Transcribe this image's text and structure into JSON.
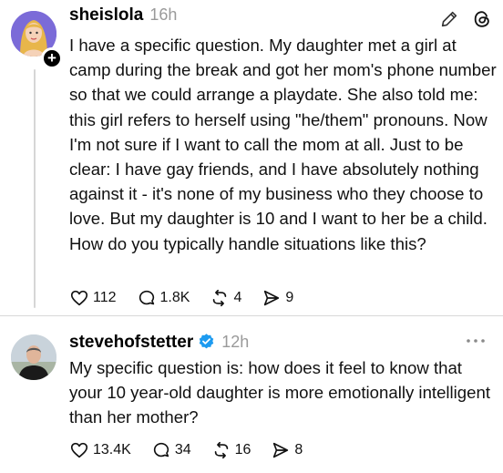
{
  "posts": [
    {
      "username": "sheislola",
      "time": "16h",
      "text": "I have a specific question. My daughter met a girl at camp during the break and got her mom's phone number so that we could arrange a playdate. She also told me: this girl refers to herself using \"he/them\" pronouns. Now I'm not sure if I want to call the mom at all. Just to be clear: I have gay friends, and I have absolutely nothing against it - it's none of my business who they choose to love. But my daughter is 10 and I want to her be a child. How do you typically handle situations like this?",
      "likes": "112",
      "replies": "1.8K",
      "reposts": "4",
      "shares": "9"
    },
    {
      "username": "stevehofstetter",
      "time": "12h",
      "text": "My specific question is: how does it feel to know that your 10 year-old daughter is more emotionally intelligent than her mother?",
      "likes": "13.4K",
      "replies": "34",
      "reposts": "16",
      "shares": "8"
    }
  ],
  "icons": [
    "pencil-icon",
    "threads-logo-icon",
    "heart-icon",
    "comment-icon",
    "repost-icon",
    "share-icon",
    "verified-icon",
    "more-icon",
    "plus-icon"
  ],
  "colors": {
    "verified": "#1d9bf0",
    "muted": "#9a9a9a",
    "avatar1_bg": "#7b6bd8"
  }
}
